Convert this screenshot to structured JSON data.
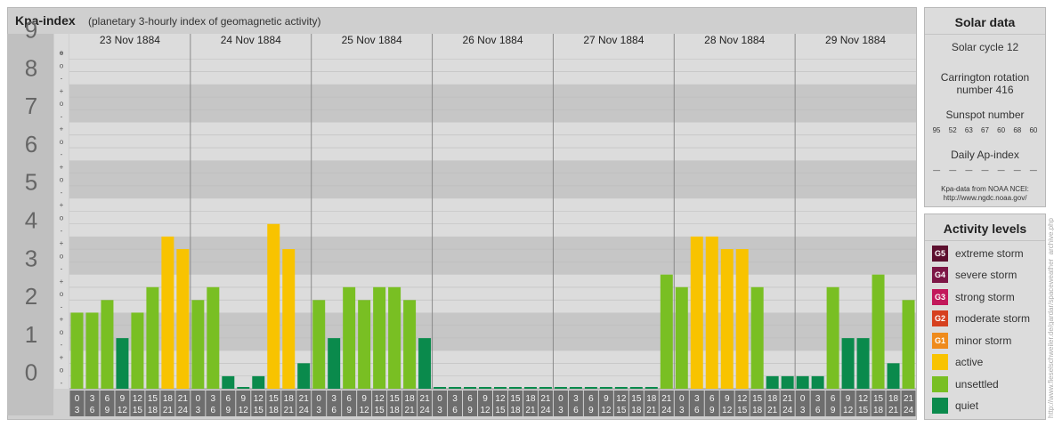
{
  "header": {
    "title": "Kpa-index",
    "subtitle": "(planetary 3-hourly index of geomagnetic activity)"
  },
  "chart_data": {
    "type": "bar",
    "title": "Kpa-index",
    "subtitle": "(planetary 3-hourly index of geomagnetic activity)",
    "xlabel": "",
    "ylabel": "",
    "ylim": [
      0,
      9
    ],
    "y_ticks": [
      "0",
      "1",
      "2",
      "3",
      "4",
      "5",
      "6",
      "7",
      "8",
      "9"
    ],
    "sub_ticks": [
      "-",
      "o",
      "+"
    ],
    "days": [
      "23 Nov 1884",
      "24 Nov 1884",
      "25 Nov 1884",
      "26 Nov 1884",
      "27 Nov 1884",
      "28 Nov 1884",
      "29 Nov 1884"
    ],
    "interval_labels": [
      [
        "0",
        "3"
      ],
      [
        "3",
        "6"
      ],
      [
        "6",
        "9"
      ],
      [
        "9",
        "12"
      ],
      [
        "12",
        "15"
      ],
      [
        "15",
        "18"
      ],
      [
        "18",
        "21"
      ],
      [
        "21",
        "24"
      ]
    ],
    "values": [
      [
        2.0,
        2.0,
        2.33,
        1.33,
        2.0,
        2.67,
        4.0,
        3.67
      ],
      [
        2.33,
        2.67,
        0.33,
        0.0,
        0.33,
        4.33,
        3.67,
        0.67
      ],
      [
        2.33,
        1.33,
        2.67,
        2.33,
        2.67,
        2.67,
        2.33,
        1.33
      ],
      [
        0.0,
        0.0,
        0.0,
        0.0,
        0.0,
        0.0,
        0.0,
        0.0
      ],
      [
        0.0,
        0.0,
        0.0,
        0.0,
        0.0,
        0.0,
        0.0,
        3.0
      ],
      [
        2.67,
        4.0,
        4.0,
        3.67,
        3.67,
        2.67,
        0.33,
        0.33
      ],
      [
        0.33,
        0.33,
        2.67,
        1.33,
        1.33,
        3.0,
        0.67,
        2.33
      ]
    ],
    "colors": {
      "quiet": "#0a8a4c",
      "unsettled": "#79bf23",
      "active": "#f8c300",
      "panel_bg": "#cfcfcf",
      "band_dark": "#c6c6c6",
      "band_light": "#dcdcdc",
      "axis_col": "#c0c0c0",
      "axis_num": "#666666",
      "interval_bg": "#6e6e6e",
      "grid": "#bcbcbc",
      "day_sep": "#8a8a8a"
    }
  },
  "solar": {
    "title": "Solar data",
    "cycle": "Solar cycle 12",
    "carrington_line1": "Carrington rotation",
    "carrington_line2": "number 416",
    "sunspot_title": "Sunspot number",
    "sunspots": [
      "95",
      "52",
      "63",
      "67",
      "60",
      "68",
      "60"
    ],
    "ap_title": "Daily Ap-index",
    "ap_values": [
      "—",
      "—",
      "—",
      "—",
      "—",
      "—",
      "—"
    ],
    "source_line1": "Kpa-data from NOAA NCEI:",
    "source_line2": "http://www.ngdc.noaa.gov/"
  },
  "activity": {
    "title": "Activity levels",
    "levels": [
      {
        "code": "G5",
        "label": "extreme storm",
        "color": "#5c0f2e"
      },
      {
        "code": "G4",
        "label": "severe storm",
        "color": "#7d1646"
      },
      {
        "code": "G3",
        "label": "strong storm",
        "color": "#c2185b"
      },
      {
        "code": "G2",
        "label": "moderate storm",
        "color": "#d6401e"
      },
      {
        "code": "G1",
        "label": "minor storm",
        "color": "#ef8b1c"
      },
      {
        "code": "",
        "label": "active",
        "color": "#f8c300"
      },
      {
        "code": "",
        "label": "unsettled",
        "color": "#79bf23"
      },
      {
        "code": "",
        "label": "quiet",
        "color": "#0a8a4c"
      }
    ]
  },
  "credit": "http://www.fieselschweiler.de/gardar/spaceweather_archive.php"
}
